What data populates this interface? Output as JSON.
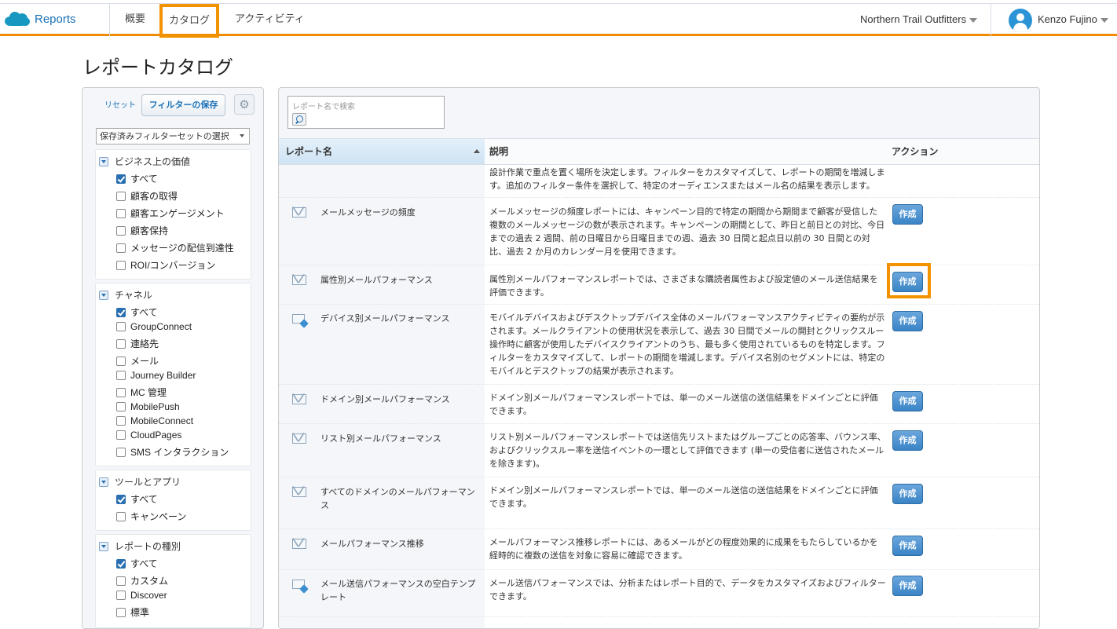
{
  "topbar": {
    "app_name": "Reports",
    "tabs": [
      {
        "label": "概要"
      },
      {
        "label": "カタログ",
        "active": true
      },
      {
        "label": "アクティビティ"
      }
    ],
    "org_name": "Northern Trail Outfitters",
    "user_name": "Kenzo Fujino"
  },
  "page": {
    "title": "レポートカタログ"
  },
  "colors": {
    "accent": "#f39200",
    "brand": "#1798c1",
    "button": "#3a84c6"
  },
  "filter": {
    "reset_label": "リセット",
    "save_label": "フィルターの保存",
    "gear_icon": "gear-icon",
    "saved_select": "保存済みフィルターセットの選択",
    "groups": [
      {
        "title": "ビジネス上の価値",
        "options": [
          {
            "label": "すべて",
            "checked": true
          },
          {
            "label": "顧客の取得",
            "checked": false
          },
          {
            "label": "顧客エンゲージメント",
            "checked": false
          },
          {
            "label": "顧客保持",
            "checked": false
          },
          {
            "label": "メッセージの配信到達性",
            "checked": false
          },
          {
            "label": "ROI/コンバージョン",
            "checked": false
          }
        ]
      },
      {
        "title": "チャネル",
        "options": [
          {
            "label": "すべて",
            "checked": true
          },
          {
            "label": "GroupConnect",
            "checked": false
          },
          {
            "label": "連絡先",
            "checked": false
          },
          {
            "label": "メール",
            "checked": false
          },
          {
            "label": "Journey Builder",
            "checked": false
          },
          {
            "label": "MC 管理",
            "checked": false
          },
          {
            "label": "MobilePush",
            "checked": false
          },
          {
            "label": "MobileConnect",
            "checked": false
          },
          {
            "label": "CloudPages",
            "checked": false
          },
          {
            "label": "SMS インタラクション",
            "checked": false
          }
        ]
      },
      {
        "title": "ツールとアプリ",
        "options": [
          {
            "label": "すべて",
            "checked": true
          },
          {
            "label": "キャンペーン",
            "checked": false
          }
        ]
      },
      {
        "title": "レポートの種別",
        "options": [
          {
            "label": "すべて",
            "checked": true
          },
          {
            "label": "カスタム",
            "checked": false
          },
          {
            "label": "Discover",
            "checked": false
          },
          {
            "label": "標準",
            "checked": false
          }
        ]
      }
    ]
  },
  "catalog": {
    "search_placeholder": "レポート名で検索",
    "columns": {
      "name": "レポート名",
      "description": "説明",
      "action": "アクション"
    },
    "create_label": "作成",
    "rows": [
      {
        "name": "",
        "icon": "",
        "description": "設計作業で重点を置く場所を決定します。フィルターをカスタマイズして、レポートの期間を増減します。追加のフィルター条件を選択して、特定のオーディエンスまたはメール名の結果を表示します。",
        "has_button": false
      },
      {
        "name": "メールメッセージの頻度",
        "icon": "envelope-icon",
        "description": "メールメッセージの頻度レポートには、キャンペーン目的で特定の期間から期間まで顧客が受信した複数のメールメッセージの数が表示されます。キャンペーンの期間として、昨日と前日との対比、今日までの過去 2 週間、前の日曜日から日曜日までの週、過去 30 日間と起点日以前の 30 日間との対比、過去 2 か月のカレンダー月を使用できます。",
        "has_button": true
      },
      {
        "name": "属性別メールパフォーマンス",
        "icon": "envelope-icon",
        "description": "属性別メールパフォーマンスレポートでは、さまざまな購読者属性および設定値のメール送信結果を評価できます。",
        "has_button": true
      },
      {
        "name": "デバイス別メールパフォーマンス",
        "icon": "device-envelope-icon",
        "description": "モバイルデバイスおよびデスクトップデバイス全体のメールパフォーマンスアクティビティの要約が示されます。メールクライアントの使用状況を表示して、過去 30 日間でメールの開封とクリックスルー操作時に顧客が使用したデバイスクライアントのうち、最も多く使用されているものを特定します。フィルターをカスタマイズして、レポートの期間を増減します。デバイス名別のセグメントには、特定のモバイルとデスクトップの結果が表示されます。",
        "has_button": true
      },
      {
        "name": "ドメイン別メールパフォーマンス",
        "icon": "envelope-icon",
        "description": "ドメイン別メールパフォーマンスレポートでは、単一のメール送信の送信結果をドメインごとに評価できます。",
        "has_button": true
      },
      {
        "name": "リスト別メールパフォーマンス",
        "icon": "envelope-icon",
        "description": "リスト別メールパフォーマンスレポートでは送信先リストまたはグループごとの応答率、バウンス率、およびクリックスルー率を送信イベントの一環として評価できます (単一の受信者に送信されたメールを除きます)。",
        "has_button": true
      },
      {
        "name": "すべてのドメインのメールパフォーマンス",
        "icon": "envelope-icon",
        "description": "ドメイン別メールパフォーマンスレポートでは、単一のメール送信の送信結果をドメインごとに評価できます。",
        "has_button": true
      },
      {
        "name": "メールパフォーマンス推移",
        "icon": "envelope-icon",
        "description": "メールパフォーマンス推移レポートには、あるメールがどの程度効果的に成果をもたらしているかを経時的に複数の送信を対象に容易に確認できます。",
        "has_button": true
      },
      {
        "name": "メール送信パフォーマンスの空白テンプレート",
        "icon": "device-envelope-icon",
        "description": "メール送信パフォーマンスでは、分析またはレポート目的で、データをカスタマイズおよびフィルターできます。",
        "has_button": true
      }
    ]
  }
}
